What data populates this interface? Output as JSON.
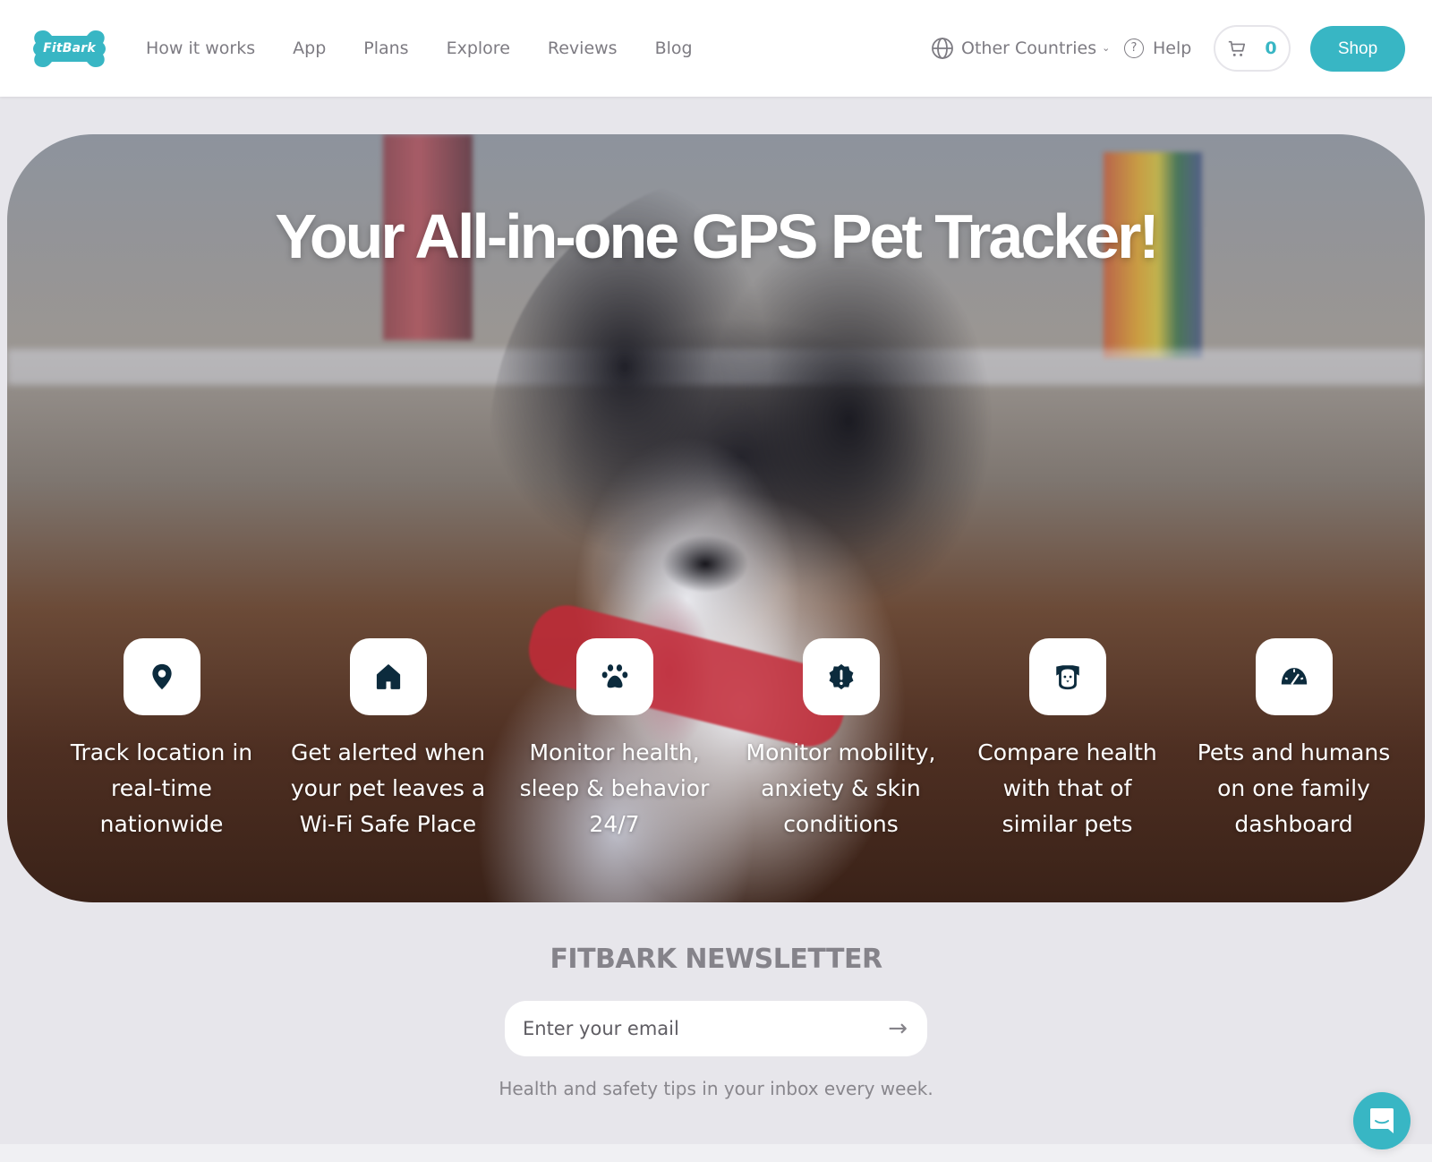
{
  "brand": {
    "name": "FitBark",
    "accent": "#38b6c4"
  },
  "nav": {
    "links": [
      {
        "label": "How it works"
      },
      {
        "label": "App"
      },
      {
        "label": "Plans"
      },
      {
        "label": "Explore"
      },
      {
        "label": "Reviews"
      },
      {
        "label": "Blog"
      }
    ],
    "region": {
      "label": "Other Countries",
      "icon": "globe-icon"
    },
    "help": {
      "label": "Help",
      "icon": "question-circle-icon"
    },
    "cart": {
      "count": "0",
      "icon": "cart-icon"
    },
    "shop_label": "Shop"
  },
  "hero": {
    "title": "Your All-in-one GPS Pet Tracker!",
    "features": [
      {
        "icon": "location-pin-icon",
        "text": "Track location in real-time nationwide"
      },
      {
        "icon": "home-icon",
        "text": "Get alerted when your pet leaves a Wi-Fi Safe Place"
      },
      {
        "icon": "paw-icon",
        "text": "Monitor health, sleep & behavior 24/7"
      },
      {
        "icon": "alert-badge-icon",
        "text": "Monitor mobility, anxiety & skin conditions"
      },
      {
        "icon": "dog-face-icon",
        "text": "Compare health with that of similar pets"
      },
      {
        "icon": "gauge-icon",
        "text": "Pets and humans on one family dashboard"
      }
    ]
  },
  "newsletter": {
    "title": "FITBARK NEWSLETTER",
    "email_placeholder": "Enter your email",
    "email_value": "",
    "subtitle": "Health and safety tips in your inbox every week."
  },
  "chat": {
    "icon": "chat-icon"
  }
}
